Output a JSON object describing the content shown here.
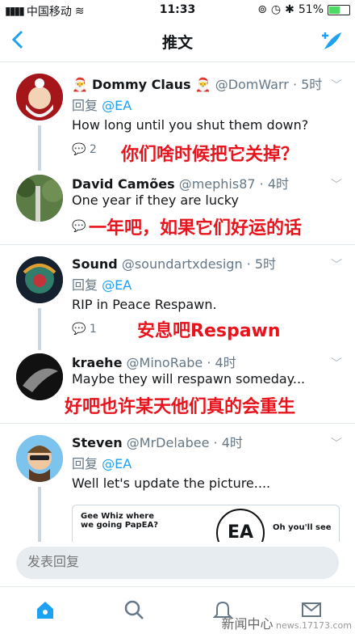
{
  "status": {
    "carrier": "中国移动",
    "time": "11:33",
    "battery": "51%",
    "battery_level": 0.51
  },
  "nav": {
    "title": "推文"
  },
  "tweets": [
    {
      "name": "Dommy Claus",
      "handle": "@DomWarr",
      "time": "· 5时",
      "reply_label": "回复",
      "reply_to": "@EA",
      "text": "How long until you shut them down?",
      "reply_count": "2",
      "overlay": "你们啥时候把它关掉？"
    },
    {
      "name": "David Camões",
      "handle": "@mephis87",
      "time": "· 4时",
      "text": "One year if they are lucky",
      "overlay": "一年吧，如果它们好运的话"
    },
    {
      "name": "Sound",
      "handle": "@soundartxdesign",
      "time": "· 5时",
      "reply_label": "回复",
      "reply_to": "@EA",
      "text": "RIP in Peace Respawn.",
      "reply_count": "1",
      "overlay": "安息吧Respawn"
    },
    {
      "name": "kraehe",
      "handle": "@MinoRabe",
      "time": "· 4时",
      "text": "Maybe they will respawn someday...",
      "overlay": "好吧也许某天他们真的会重生"
    },
    {
      "name": "Steven",
      "handle": "@MrDelabee",
      "time": "· 4时",
      "reply_label": "回复",
      "reply_to": "@EA",
      "text": "Well let's update the picture....",
      "card": {
        "bubble_left": "Gee Whiz where we going PapEA?",
        "logo": "EA",
        "bubble_right": "Oh you'll see"
      }
    }
  ],
  "reply": {
    "placeholder": "发表回复"
  },
  "watermark": {
    "site": "news.17173.com",
    "brand": "新闻中心"
  }
}
